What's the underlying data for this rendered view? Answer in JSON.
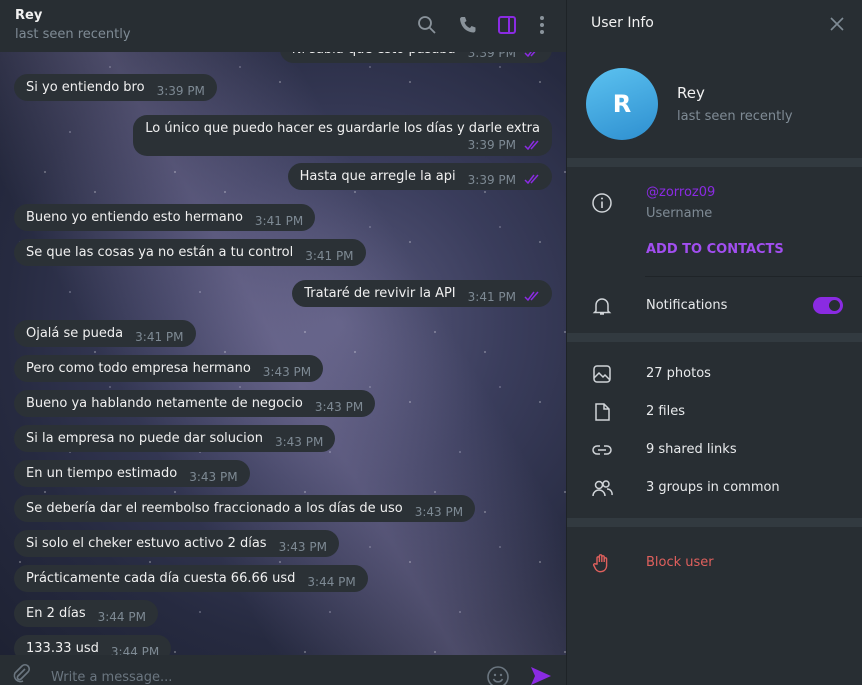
{
  "chat": {
    "name": "Rey",
    "status": "last seen recently",
    "icons": [
      "search-icon",
      "phone-icon",
      "sidebar-toggle-icon",
      "more-vertical-icon"
    ],
    "messages": [
      {
        "text": "Ni sabía que esto pasaba",
        "time": "3:39 PM",
        "out": true
      },
      {
        "text": "Si yo entiendo bro",
        "time": "3:39 PM",
        "out": false
      },
      {
        "text": "Lo único que puedo hacer es guardarle los días y darle extra",
        "time": "3:39 PM",
        "out": true
      },
      {
        "text": "Hasta que arregle la api",
        "time": "3:39 PM",
        "out": true
      },
      {
        "text": "Bueno yo entiendo esto hermano",
        "time": "3:41 PM",
        "out": false
      },
      {
        "text": "Se que las cosas ya no están a tu control",
        "time": "3:41 PM",
        "out": false
      },
      {
        "text": "Trataré de revivir la API",
        "time": "3:41 PM",
        "out": true
      },
      {
        "text": "Ojalá se pueda",
        "time": "3:41 PM",
        "out": false
      },
      {
        "text": "Pero como todo empresa hermano",
        "time": "3:43 PM",
        "out": false
      },
      {
        "text": "Bueno ya hablando netamente de negocio",
        "time": "3:43 PM",
        "out": false
      },
      {
        "text": "Si la empresa no puede dar solucion",
        "time": "3:43 PM",
        "out": false
      },
      {
        "text": "En un tiempo estimado",
        "time": "3:43 PM",
        "out": false
      },
      {
        "text": "Se debería dar el reembolso fraccionado a los días de uso",
        "time": "3:43 PM",
        "out": false
      },
      {
        "text": "Si solo el cheker estuvo activo 2 días",
        "time": "3:43 PM",
        "out": false
      },
      {
        "text": "Prácticamente cada día cuesta 66.66 usd",
        "time": "3:44 PM",
        "out": false
      },
      {
        "text": "En 2 días",
        "time": "3:44 PM",
        "out": false
      },
      {
        "text": "133.33 usd",
        "time": "3:44 PM",
        "out": false
      }
    ],
    "input_placeholder": "Write a message..."
  },
  "panel": {
    "title": "User Info",
    "avatar_letter": "R",
    "name": "Rey",
    "status": "last seen recently",
    "username": "@zorroz09",
    "username_label": "Username",
    "add_contacts": "ADD TO CONTACTS",
    "notifications": "Notifications",
    "notifications_on": true,
    "media": [
      "27 photos",
      "2 files",
      "9 shared links",
      "3 groups in common"
    ],
    "block": "Block user"
  },
  "colors": {
    "accent": "#8a2be2",
    "danger": "#e0605d",
    "avatar": "#3b9fd9"
  }
}
